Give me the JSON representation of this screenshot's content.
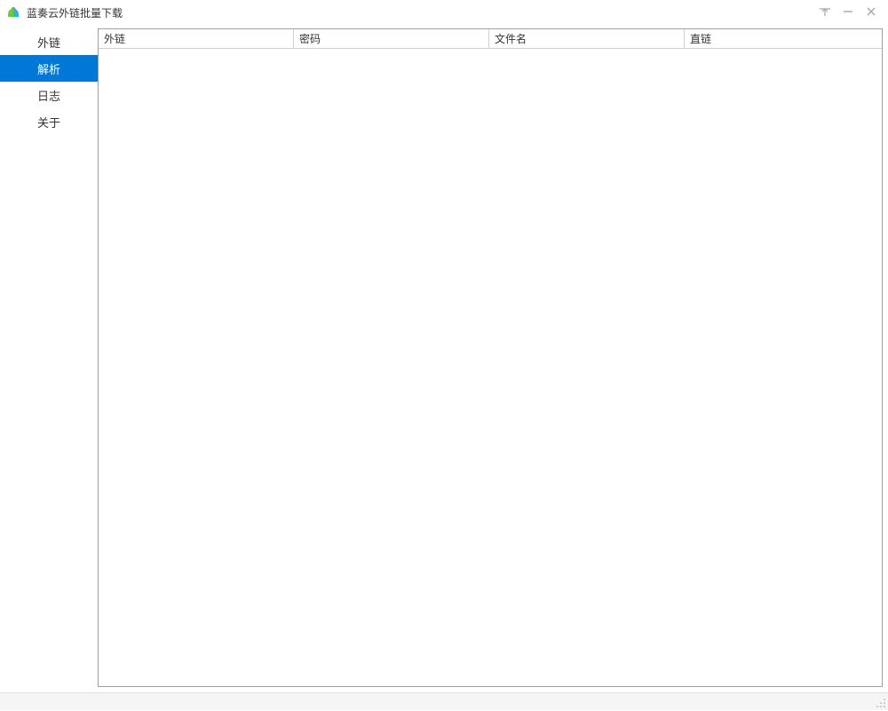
{
  "window": {
    "title": "蓝奏云外链批量下载"
  },
  "sidebar": {
    "items": [
      {
        "label": "外链",
        "active": false
      },
      {
        "label": "解析",
        "active": true
      },
      {
        "label": "日志",
        "active": false
      },
      {
        "label": "关于",
        "active": false
      }
    ]
  },
  "table": {
    "headers": [
      {
        "label": "外链"
      },
      {
        "label": "密码"
      },
      {
        "label": "文件名"
      },
      {
        "label": "直链"
      }
    ],
    "rows": []
  }
}
